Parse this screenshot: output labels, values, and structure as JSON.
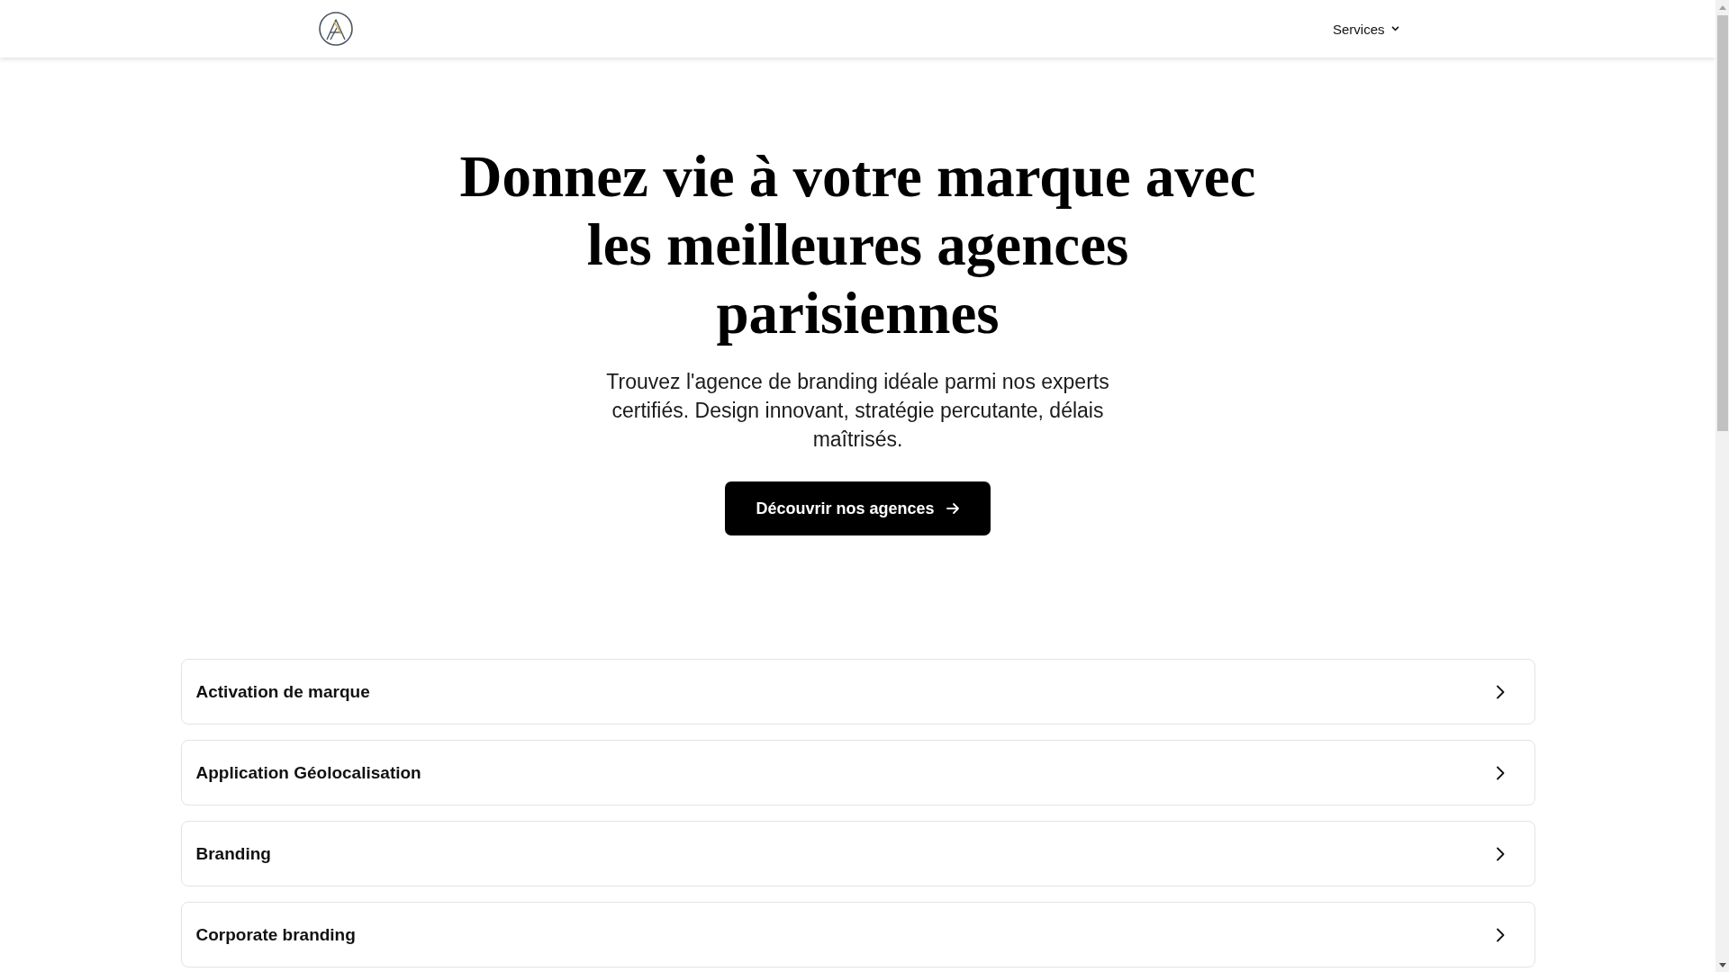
{
  "header": {
    "menu": [
      {
        "label": "Services",
        "kind": "dropdown"
      }
    ]
  },
  "hero": {
    "title": "Donnez vie à votre marque avec les meilleures agences parisiennes",
    "subtitle": "Trouvez l'agence de branding idéale parmi nos experts certifiés. Design innovant, stratégie percutante, délais maîtrisés.",
    "cta": {
      "label": "Découvrir nos agences"
    }
  },
  "services": [
    {
      "label": "Activation de marque"
    },
    {
      "label": "Application Géolocalisation"
    },
    {
      "label": "Branding"
    },
    {
      "label": "Corporate branding"
    }
  ]
}
